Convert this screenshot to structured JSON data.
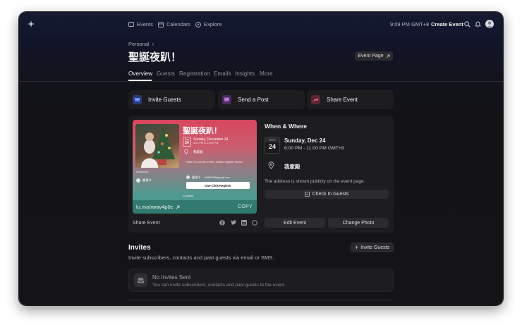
{
  "nav": {
    "events": "Events",
    "calendars": "Calendars",
    "explore": "Explore",
    "time": "9:09 PM GMT+8",
    "create_event": "Create Event"
  },
  "header": {
    "breadcrumb": "Personal",
    "title": "聖誕夜趴！",
    "event_page_button": "Event Page"
  },
  "tabs": [
    "Overview",
    "Guests",
    "Registration",
    "Emails",
    "Insights",
    "More"
  ],
  "actions": {
    "invite_guests": "Invite Guests",
    "send_post": "Send a Post",
    "share_event": "Share Event"
  },
  "preview": {
    "title": "聖誕夜趴！",
    "month": "Dec",
    "day": "24",
    "date": "Sunday, December 24",
    "time": "6:00 PM to 11:00 PM",
    "location": "我家殿",
    "hosted_by": "Hosted By",
    "host": "露意守",
    "registration_text": "Hello! To join the event, please register below.",
    "user_name": "露意守",
    "user_email": "c03952035@gmail.com",
    "register_button": "One-Click Register",
    "location_label": "Location"
  },
  "share": {
    "link": "lu.ma/rwav4p0c",
    "copy": "COPY",
    "label": "Share Event"
  },
  "when_where": {
    "heading": "When & Where",
    "month": "DEC",
    "day": "24",
    "date": "Sunday, Dec 24",
    "time": "6:00 PM - 11:00 PM GMT+8",
    "location": "我家殿",
    "note": "The address is shown publicly on the event page.",
    "check_in": "Check In Guests"
  },
  "buttons": {
    "edit_event": "Edit Event",
    "change_photo": "Change Photo"
  },
  "invites": {
    "heading": "Invites",
    "description": "Invite subscribers, contacts and past guests via email or SMS.",
    "button": "Invite Guests",
    "empty_title": "No Invites Sent",
    "empty_text": "You can invite subscribers, contacts and past guests to the event."
  },
  "colors": {
    "invite_accent": "#4b6cf7",
    "post_accent": "#b26bd9",
    "share_accent": "#e0607a",
    "preview_top": "#d9455d",
    "preview_bottom": "#3e9b8d"
  },
  "icons": {
    "logo": "sparkle-icon",
    "search": "search-icon",
    "bell": "bell-icon"
  }
}
